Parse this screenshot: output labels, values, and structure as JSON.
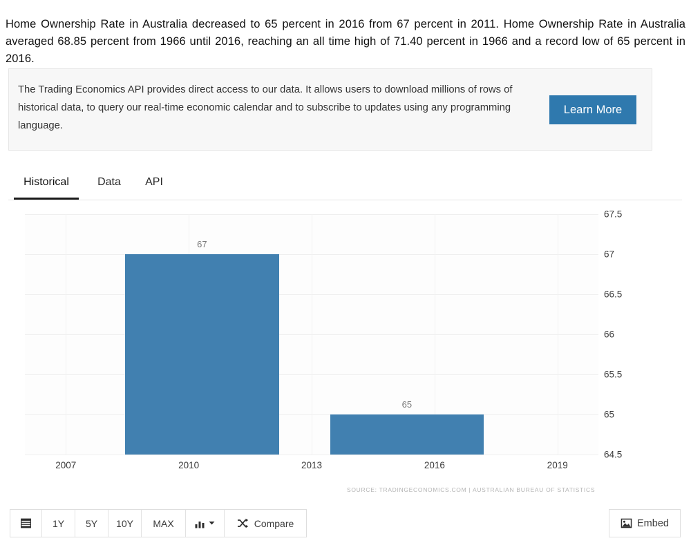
{
  "intro": {
    "paragraph": "Home Ownership Rate in Australia decreased to 65 percent in 2016 from 67 percent in 2011. Home Ownership Rate in Australia averaged 68.85 percent from 1966 until 2016, reaching an all time high of 71.40 percent in 1966 and a record low of 65 percent in 2016."
  },
  "promo": {
    "text": "The Trading Economics API provides direct access to our data. It allows users to download millions of rows of historical data, to query our real-time economic calendar and to subscribe to updates using any programming language.",
    "button_label": "Learn More",
    "button_color": "#2f79ae"
  },
  "tabs": [
    {
      "label": "Historical",
      "active": true
    },
    {
      "label": "Data",
      "active": false
    },
    {
      "label": "API",
      "active": false
    }
  ],
  "chart_data": {
    "type": "bar",
    "title": "",
    "subtitle": "",
    "xlabel": "",
    "ylabel": "",
    "x": [
      2011,
      2016
    ],
    "categories": [
      "2011",
      "2016"
    ],
    "values": [
      67,
      65
    ],
    "data_labels": [
      "67",
      "65"
    ],
    "series": [
      {
        "name": "Home Ownership Rate",
        "values": [
          67,
          65
        ]
      }
    ],
    "ylim": [
      64.5,
      67.5
    ],
    "yticks": [
      "67.5",
      "67",
      "66.5",
      "66",
      "65.5",
      "65",
      "64.5"
    ],
    "ytick_values": [
      67.5,
      67,
      66.5,
      66,
      65.5,
      65,
      64.5
    ],
    "xlim": [
      2006,
      2020
    ],
    "xticks": [
      "2007",
      "2010",
      "2013",
      "2016",
      "2019"
    ],
    "xtick_values": [
      2007,
      2010,
      2013,
      2016,
      2019
    ],
    "grid": true,
    "legend": false,
    "bar_color": "#4180b0",
    "source": "SOURCE: TRADINGECONOMICS.COM | AUSTRALIAN BUREAU OF STATISTICS"
  },
  "toolbar": {
    "calendar_icon": "calendar-icon",
    "ranges": [
      "1Y",
      "5Y",
      "10Y",
      "MAX"
    ],
    "chart_type_icon": "bar-chart-icon",
    "chart_type_caret": "▾",
    "compare_icon": "shuffle-icon",
    "compare_label": "Compare",
    "embed_icon": "image-icon",
    "embed_label": "Embed"
  }
}
